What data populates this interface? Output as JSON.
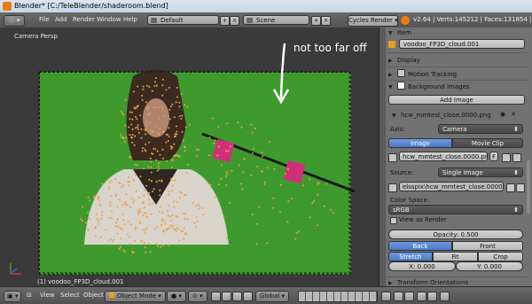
{
  "window": {
    "title": "Blender* [C:/TeleBlender/shaderoom.blend]"
  },
  "menu": {
    "items": [
      "File",
      "Add",
      "Render",
      "Window",
      "Help"
    ]
  },
  "header": {
    "screen_layout": "Default",
    "scene": "Scene",
    "render_engine": "Cycles Render",
    "stats": "v2.64 | Verts:145212 | Faces:131854 | Ob"
  },
  "viewport": {
    "view_label": "Camera Persp",
    "annotation": "not too far off",
    "object_label": "(1) voodoo_FP3D_cloud.001"
  },
  "bottom": {
    "menus": [
      "View",
      "Select",
      "Object"
    ],
    "mode": "Object Mode",
    "orientation": "Global"
  },
  "panel": {
    "item_header": "Item",
    "object_name": "voodoo_FP3D_cloud.001",
    "display_header": "Display",
    "motion_header": "Motion Tracking",
    "bg_header": "Background Images",
    "add_image": "Add Image",
    "image_name": "hcw_mmtest_close.0000.png",
    "axis_label": "Axis:",
    "axis_value": "Camera",
    "tab_image": "Image",
    "tab_movie": "Movie Clip",
    "file_field": "hcw_mmtest_close.0000.png",
    "file_flag": "F",
    "source_label": "Source:",
    "source_value": "Single Image",
    "path_value": "elsspix\\hcw_mmtest_close.0000.png",
    "colorspace_label": "Color Space:",
    "colorspace_value": "sRGB",
    "view_as_render": "View as Render",
    "opacity": "Opacity: 0.500",
    "back": "Back",
    "front": "Front",
    "stretch": "Stretch",
    "fit": "Fit",
    "crop": "Crop",
    "x": "X: 0.000",
    "y": "Y: 0.000",
    "transform_header": "Transform Orientations"
  },
  "colors": {
    "accent_blue": "#5a86d6",
    "green_screen": "#3f9a2e",
    "point_cloud": "#f0a040",
    "marker_pink": "#d0307a"
  }
}
